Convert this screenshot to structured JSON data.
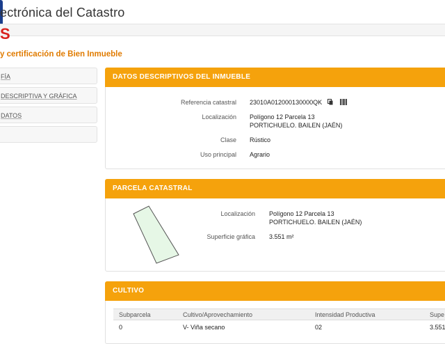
{
  "header": {
    "site_title": "ectrónica del Catastro",
    "red_fragment": "S",
    "page_subtitle": "y certificación de Bien Inmueble"
  },
  "sidebar": {
    "items": [
      {
        "label": "FÍA"
      },
      {
        "label": "DESCRIPTIVA Y GRÁFICA"
      },
      {
        "label": "DATOS"
      },
      {
        "label": ""
      }
    ]
  },
  "datos": {
    "title": "DATOS DESCRIPTIVOS DEL INMUEBLE",
    "ref_label": "Referencia catastral",
    "ref_value": "23010A012000130000QK",
    "loc_label": "Localización",
    "loc_line1": "Polígono 12 Parcela 13",
    "loc_line2": "PORTICHUELO. BAILEN (JAÉN)",
    "clase_label": "Clase",
    "clase_value": "Rústico",
    "uso_label": "Uso principal",
    "uso_value": "Agrario"
  },
  "parcela": {
    "title": "PARCELA CATASTRAL",
    "loc_label": "Localización",
    "loc_line1": "Polígono 12 Parcela 13",
    "loc_line2": "PORTICHUELO. BAILEN (JAÉN)",
    "sup_label": "Superficie gráfica",
    "sup_value": "3.551 m²"
  },
  "cultivo": {
    "title": "CULTIVO",
    "columns": [
      "Subparcela",
      "Cultivo/Aprovechamiento",
      "Intensidad Productiva",
      "Supe"
    ],
    "rows": [
      [
        "0",
        "V- Viña secano",
        "02",
        "3.551"
      ]
    ]
  },
  "colors": {
    "accent": "#f5a20c",
    "subtitle": "#e07b00",
    "brand_red": "#d9201c",
    "parcel_fill": "#e6f7e6"
  }
}
